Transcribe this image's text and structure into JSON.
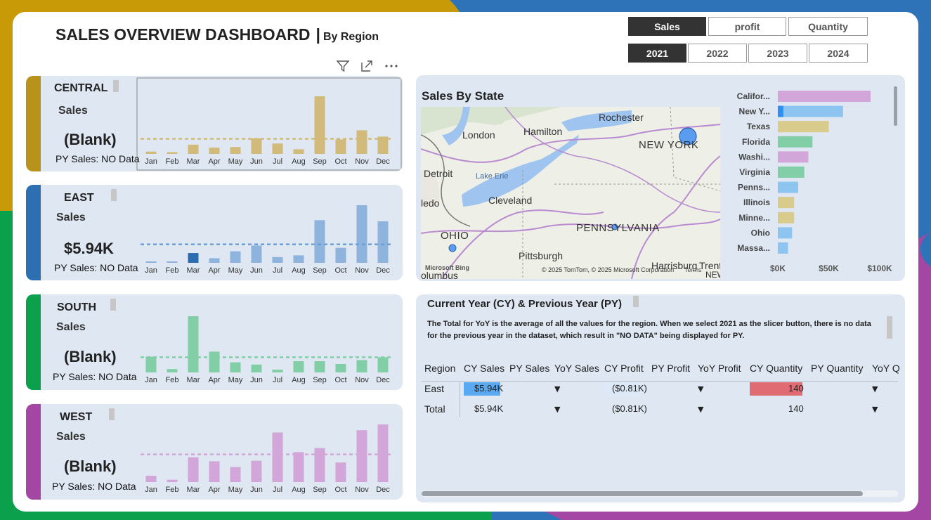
{
  "title": {
    "main": "SALES OVERVIEW DASHBOARD",
    "sep": "|",
    "sub": "By Region"
  },
  "measure_slicer": [
    {
      "label": "Sales",
      "active": true
    },
    {
      "label": "profit",
      "active": false
    },
    {
      "label": "Quantity",
      "active": false
    }
  ],
  "year_slicer": [
    {
      "label": "2021",
      "active": true
    },
    {
      "label": "2022",
      "active": false
    },
    {
      "label": "2023",
      "active": false
    },
    {
      "label": "2024",
      "active": false
    }
  ],
  "months": [
    "Jan",
    "Feb",
    "Mar",
    "Apr",
    "May",
    "Jun",
    "Jul",
    "Aug",
    "Sep",
    "Oct",
    "Nov",
    "Dec"
  ],
  "regions": [
    {
      "name": "CENTRAL",
      "label": "Sales",
      "value": "(Blank)",
      "py": "PY Sales: NO Data",
      "color": "#d2bb7a",
      "stripe": "#b8921a",
      "avg": 0.26,
      "values": [
        0.04,
        0.03,
        0.16,
        0.11,
        0.12,
        0.27,
        0.18,
        0.08,
        1.0,
        0.25,
        0.41,
        0.3
      ]
    },
    {
      "name": "EAST",
      "label": "Sales",
      "value": "$5.94K",
      "py": "PY Sales: NO Data",
      "color": "#8eb3dc",
      "stripe": "#2e6fb2",
      "highlight": 2,
      "highlight_color": "#2b6cb0",
      "avg": 0.32,
      "values": [
        0.01,
        0.01,
        0.17,
        0.08,
        0.2,
        0.3,
        0.1,
        0.13,
        0.74,
        0.26,
        1.0,
        0.72
      ]
    },
    {
      "name": "SOUTH",
      "label": "Sales",
      "value": "(Blank)",
      "py": "PY Sales: NO Data",
      "color": "#82cfa7",
      "stripe": "#0aa04c",
      "avg": 0.27,
      "values": [
        0.28,
        0.06,
        1.0,
        0.37,
        0.18,
        0.14,
        0.05,
        0.2,
        0.2,
        0.15,
        0.22,
        0.27
      ]
    },
    {
      "name": "WEST",
      "label": "Sales",
      "value": "(Blank)",
      "py": "PY Sales: NO Data",
      "color": "#d2a6d8",
      "stripe": "#a446a4",
      "avg": 0.48,
      "values": [
        0.11,
        0.04,
        0.43,
        0.36,
        0.26,
        0.37,
        0.86,
        0.52,
        0.59,
        0.34,
        0.9,
        1.0
      ]
    }
  ],
  "map": {
    "title": "Sales By State",
    "labels": [
      "Rochester",
      "London",
      "Hamilton",
      "NEW YORK",
      "Detroit",
      "Lake Erie",
      "Cleveland",
      "OHIO",
      "PENNSYLVANIA",
      "Pittsburgh",
      "Harrisburg",
      "Trent",
      "ledo",
      "olumbus",
      "NEW"
    ],
    "attribution_logo": "Microsoft Bing",
    "attribution": "© 2025 TomTom, © 2025 Microsoft Corporation",
    "terms": "Terms"
  },
  "state_chart": {
    "categories": [
      "Califor...",
      "New Y...",
      "Texas",
      "Florida",
      "Washi...",
      "Virginia",
      "Penns...",
      "Illinois",
      "Minne...",
      "Ohio",
      "Massa..."
    ],
    "values": [
      91000,
      64000,
      50000,
      34000,
      30000,
      26000,
      20000,
      16000,
      16000,
      14000,
      10000
    ],
    "colors": [
      "#d2a6d8",
      "#8ec4f0",
      "#d8cb8c",
      "#82cfa7",
      "#d2a6d8",
      "#82cfa7",
      "#8ec4f0",
      "#d8cb8c",
      "#d8cb8c",
      "#8ec4f0",
      "#8ec4f0"
    ],
    "highlight_color": "#2e8ff0",
    "highlight_index": 1,
    "highlight_value": 4000,
    "ticks": [
      "$0K",
      "$50K",
      "$100K"
    ],
    "xlim": [
      0,
      100000
    ]
  },
  "table": {
    "title": "Current Year (CY) & Previous Year (PY)",
    "note": "The Total for YoY is the average of all the values for the region. When we select 2021 as the slicer button, there is no data for the previous year in the dataset, which result in \"NO DATA\" being displayed for PY.",
    "headers": [
      "Region",
      "CY Sales",
      "PY Sales",
      "YoY Sales",
      "CY Profit",
      "PY Profit",
      "YoY Profit",
      "CY Quantity",
      "PY Quantity",
      "YoY Q"
    ],
    "rows": [
      {
        "region": "East",
        "cy_sales": "$5.94K",
        "cy_profit": "($0.81K)",
        "cy_qty": "140"
      },
      {
        "region": "Total",
        "cy_sales": "$5.94K",
        "cy_profit": "($0.81K)",
        "cy_qty": "140"
      }
    ],
    "arrow": "▼"
  },
  "colors": {
    "sales_fill": "#5aa9f0",
    "profit_fill": "#dde9f7",
    "qty_fill": "#e06b72"
  }
}
